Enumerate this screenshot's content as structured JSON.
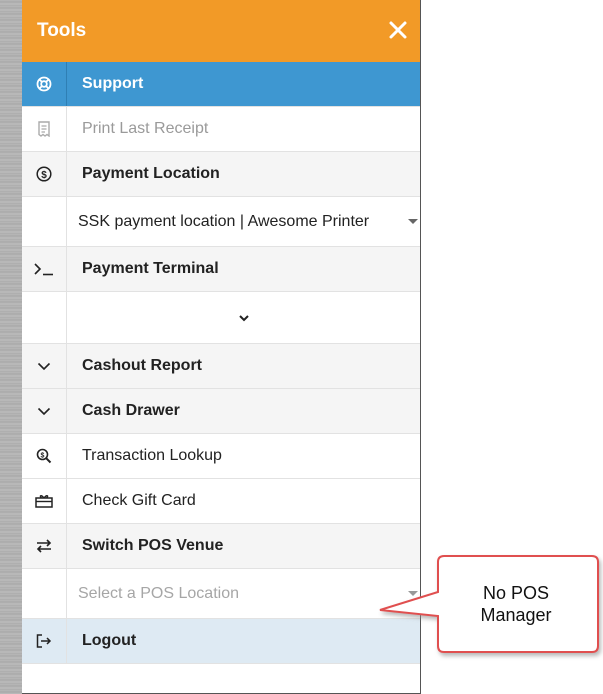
{
  "panel": {
    "title": "Tools",
    "close_icon": "close-icon",
    "header_color": "#f29a27",
    "active_color": "#3e97d1"
  },
  "menu": {
    "support": {
      "label": "Support",
      "icon": "lifebuoy-icon"
    },
    "print_last_receipt": {
      "label": "Print Last Receipt",
      "icon": "receipt-icon"
    },
    "payment_location": {
      "label": "Payment Location",
      "icon": "dollar-circle-icon"
    },
    "payment_location_select": {
      "value": "SSK payment location | Awesome Printer"
    },
    "payment_terminal": {
      "label": "Payment Terminal",
      "icon": "terminal-icon"
    },
    "payment_terminal_select": {
      "value": ""
    },
    "cashout_report": {
      "label": "Cashout Report",
      "icon": "chevron-down-icon"
    },
    "cash_drawer": {
      "label": "Cash Drawer",
      "icon": "chevron-down-icon"
    },
    "transaction_lookup": {
      "label": "Transaction Lookup",
      "icon": "search-dollar-icon"
    },
    "check_gift_card": {
      "label": "Check Gift Card",
      "icon": "gift-card-icon"
    },
    "switch_pos_venue": {
      "label": "Switch POS Venue",
      "icon": "swap-arrows-icon"
    },
    "pos_location_select": {
      "placeholder": "Select a POS Location"
    },
    "logout": {
      "label": "Logout",
      "icon": "logout-icon"
    }
  },
  "callout": {
    "text_line1": "No POS",
    "text_line2": "Manager",
    "border_color": "#e05050"
  }
}
